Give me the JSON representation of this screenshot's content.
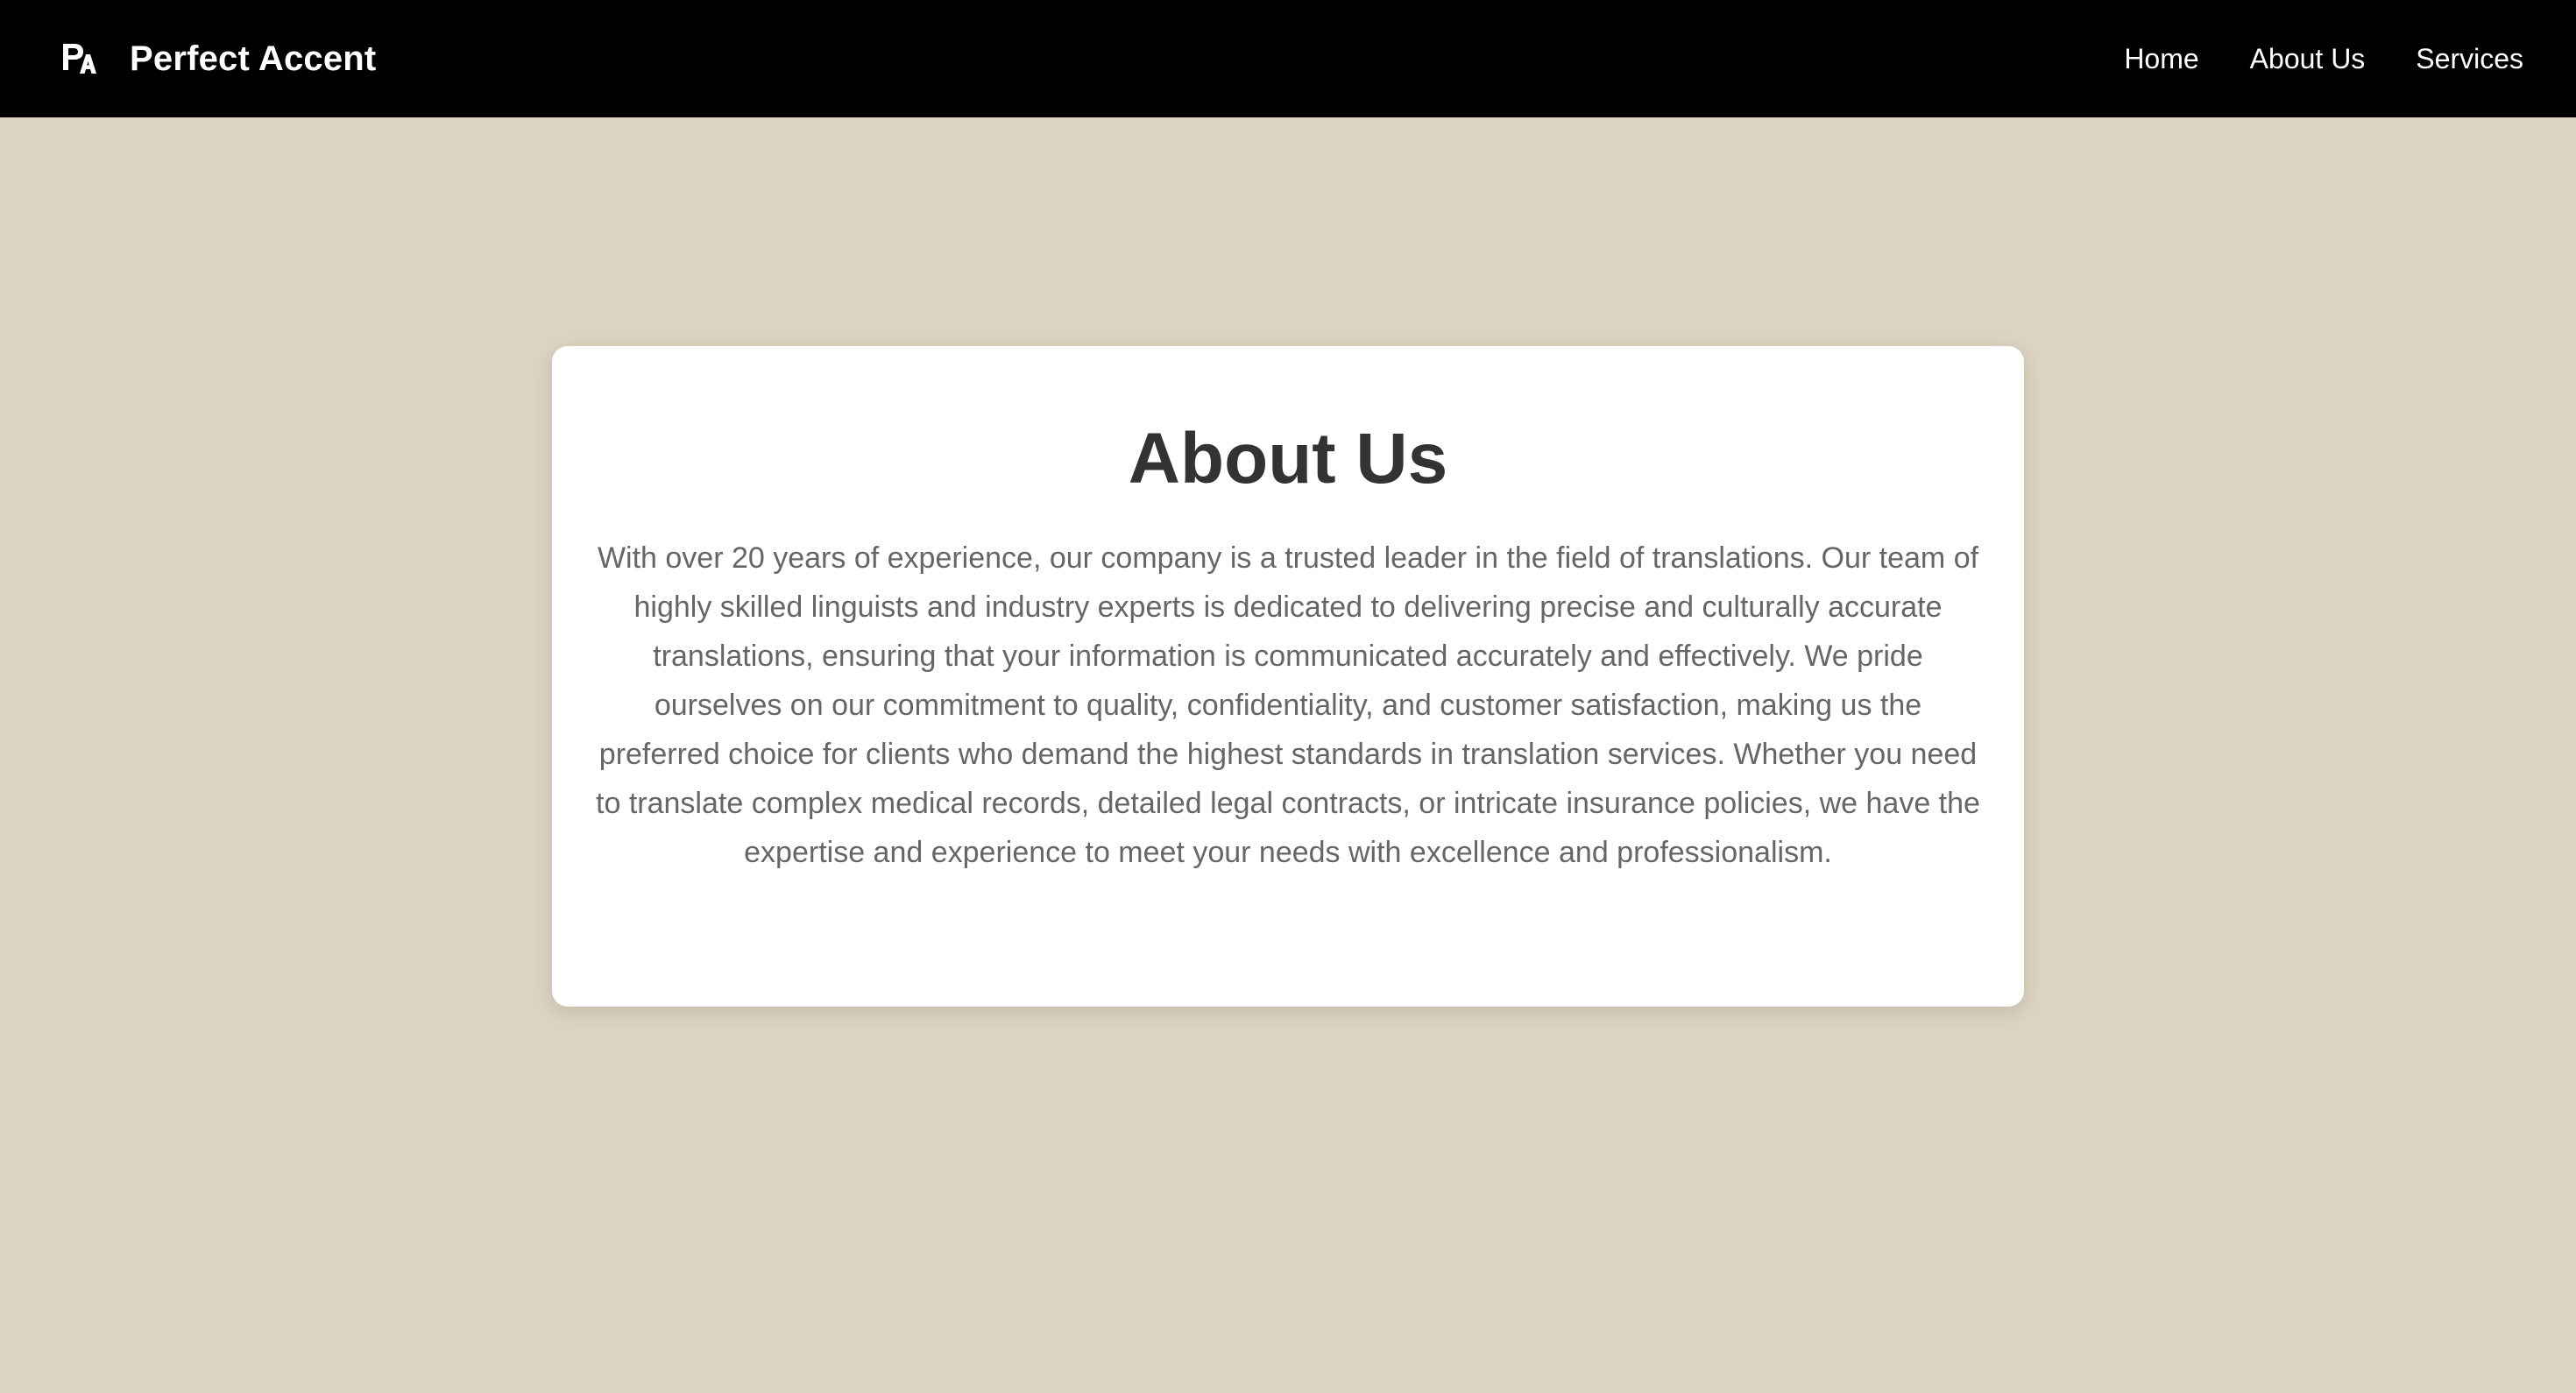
{
  "header": {
    "logo_icon": "pa-monogram-icon",
    "brand_name": "Perfect Accent",
    "nav": [
      {
        "label": "Home"
      },
      {
        "label": "About Us"
      },
      {
        "label": "Services"
      }
    ]
  },
  "about": {
    "title": "About Us",
    "body": "With over 20 years of experience, our company is a trusted leader in the field of translations. Our team of highly skilled linguists and industry experts is dedicated to delivering precise and culturally accurate translations, ensuring that your information is communicated accurately and effectively. We pride ourselves on our commitment to quality, confidentiality, and customer satisfaction, making us the preferred choice for clients who demand the highest standards in translation services. Whether you need to translate complex medical records, detailed legal contracts, or intricate insurance policies, we have the expertise and experience to meet your needs with excellence and professionalism."
  },
  "colors": {
    "header_bg": "#000000",
    "page_bg": "#ddd3c1",
    "card_bg": "#ffffff",
    "title_text": "#333333",
    "body_text": "#666666"
  }
}
